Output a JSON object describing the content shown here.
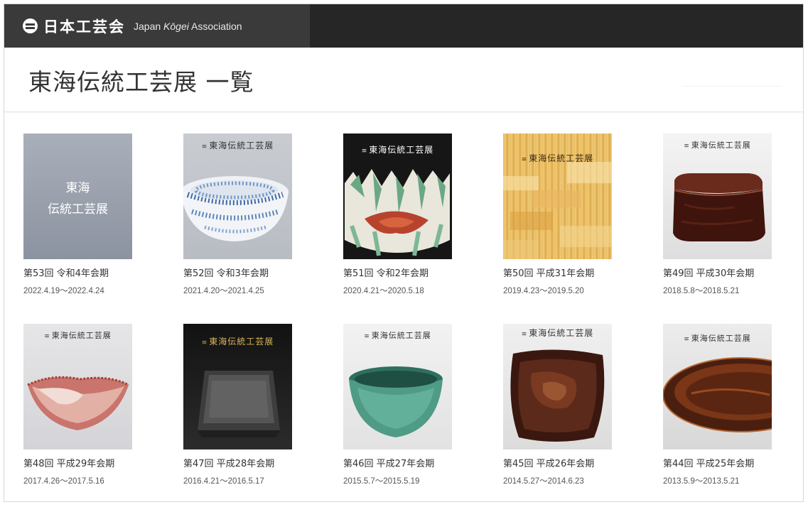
{
  "header": {
    "brand_jp": "日本工芸会",
    "brand_en_pre": "Japan ",
    "brand_en_italic": "Kōgei",
    "brand_en_post": " Association"
  },
  "page": {
    "title": "東海伝統工芸展 一覧"
  },
  "exhibitions": [
    {
      "title": "第53回 令和4年会期",
      "dates": "2022.4.19〜2022.4.24",
      "poster": "東海\n伝統工芸展"
    },
    {
      "title": "第52回 令和3年会期",
      "dates": "2021.4.20〜2021.4.25",
      "poster": "東海伝統工芸展"
    },
    {
      "title": "第51回 令和2年会期",
      "dates": "2020.4.21〜2020.5.18",
      "poster": "東海伝統工芸展"
    },
    {
      "title": "第50回 平成31年会期",
      "dates": "2019.4.23〜2019.5.20",
      "poster": "東海伝統工芸展"
    },
    {
      "title": "第49回 平成30年会期",
      "dates": "2018.5.8〜2018.5.21",
      "poster": "東海伝統工芸展"
    },
    {
      "title": "第48回 平成29年会期",
      "dates": "2017.4.26〜2017.5.16",
      "poster": "東海伝統工芸展"
    },
    {
      "title": "第47回 平成28年会期",
      "dates": "2016.4.21〜2016.5.17",
      "poster": "東海伝統工芸展"
    },
    {
      "title": "第46回 平成27年会期",
      "dates": "2015.5.7〜2015.5.19",
      "poster": "東海伝統工芸展"
    },
    {
      "title": "第45回 平成26年会期",
      "dates": "2014.5.27〜2014.6.23",
      "poster": "東海伝統工芸展"
    },
    {
      "title": "第44回 平成25年会期",
      "dates": "2013.5.9〜2013.5.21",
      "poster": "東海伝統工芸展"
    }
  ],
  "colors": {
    "topbar": "#262626",
    "brand_bg": "#3a3a3a",
    "text": "#333333"
  },
  "icons": {
    "logo": "japan-kogei-logo-icon"
  }
}
